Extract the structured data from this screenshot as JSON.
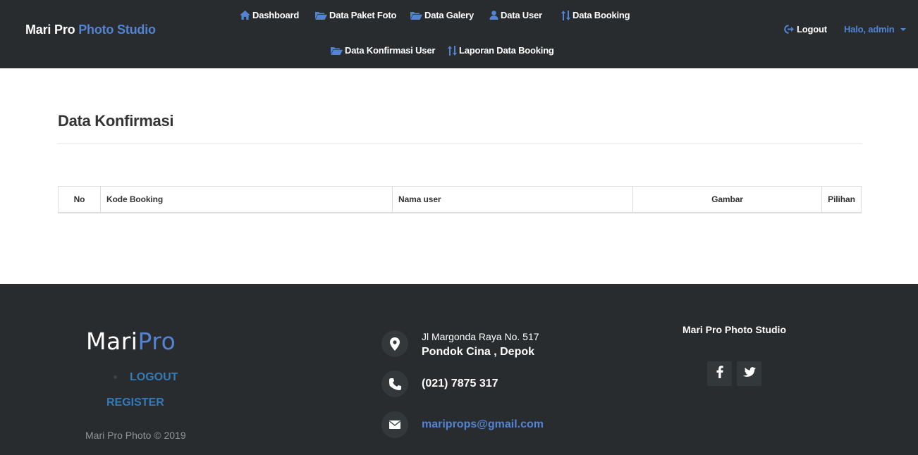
{
  "navbar": {
    "brand_main": "Mari Pro",
    "brand_accent": "Photo Studio",
    "links": {
      "dashboard": "Dashboard",
      "paket_foto": "Data Paket Foto",
      "galery": "Data Galery",
      "user": "Data User",
      "booking": "Data Booking",
      "konfirmasi": "Data Konfirmasi User",
      "laporan": "Laporan Data Booking"
    },
    "logout": "Logout",
    "greeting": "Halo, admin"
  },
  "main": {
    "title": "Data Konfirmasi",
    "table": {
      "columns": [
        "No",
        "Kode Booking",
        "Nama user",
        "Gambar",
        "Pilihan"
      ],
      "rows": []
    }
  },
  "footer": {
    "logo_main": "Mari",
    "logo_accent": "Pro",
    "links": {
      "logout": "LOGOUT",
      "register": "REGISTER"
    },
    "copyright": "Mari Pro Photo © 2019",
    "address_line1": "Jl Margonda Raya No. 517",
    "address_line2": "Pondok Cina , Depok",
    "phone": "(021) 7875 317",
    "email": "mariprops@gmail.com",
    "about_title": "Mari Pro Photo Studio"
  },
  "colors": {
    "navbar_bg": "#292c2f",
    "accent": "#5383d3",
    "footer_link": "#337ab7"
  },
  "icons": {
    "dashboard": "home-icon",
    "paket_foto": "folder-open-icon",
    "galery": "folder-open-icon",
    "user": "user-icon",
    "booking": "sort-arrows-icon",
    "konfirmasi": "folder-open-icon",
    "laporan": "sort-arrows-icon",
    "logout": "logout-icon",
    "greeting": "caret-down-icon",
    "address": "map-marker-icon",
    "phone": "phone-icon",
    "email": "envelope-icon",
    "facebook": "facebook-icon",
    "twitter": "twitter-icon"
  }
}
